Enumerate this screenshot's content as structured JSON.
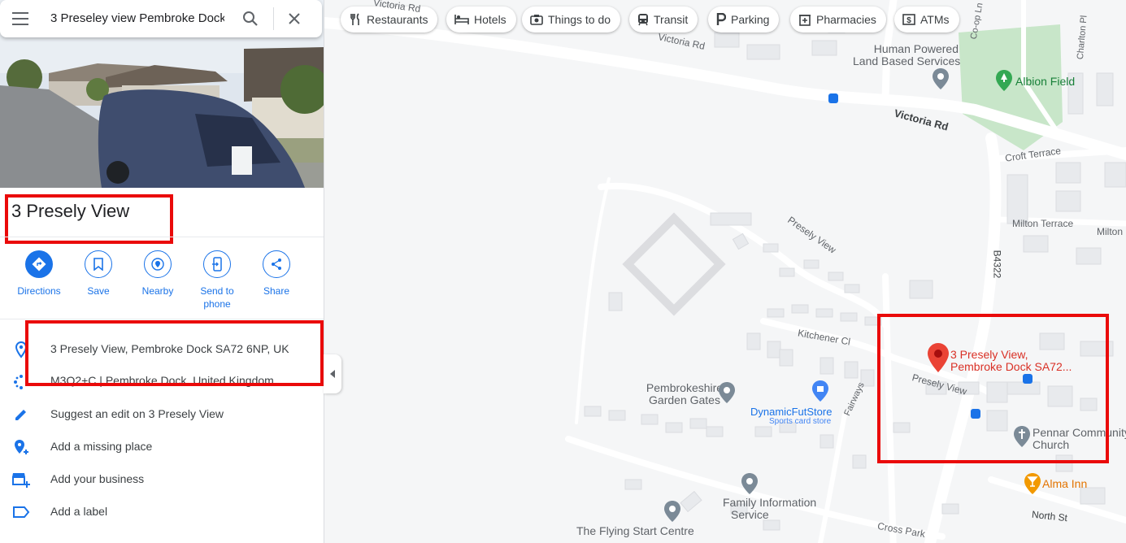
{
  "search": {
    "query": "3 Preseley view Pembroke Dock"
  },
  "place": {
    "title": "3 Presely View"
  },
  "actions": [
    {
      "label": "Directions",
      "icon": "directions-icon"
    },
    {
      "label": "Save",
      "icon": "bookmark-icon"
    },
    {
      "label": "Nearby",
      "icon": "nearby-icon"
    },
    {
      "label": "Send to\nphone",
      "icon": "send-to-phone-icon"
    },
    {
      "label": "Share",
      "icon": "share-icon"
    }
  ],
  "details": {
    "address": "3 Presely View, Pembroke Dock SA72 6NP, UK",
    "plus_code": "M3Q2+C | Pembroke Dock, United Kingdom",
    "suggest_edit": "Suggest an edit on 3 Presely View",
    "add_missing_place": "Add a missing place",
    "add_business": "Add your business",
    "add_label": "Add a label"
  },
  "chips": [
    {
      "label": "Restaurants",
      "icon": "restaurant-icon"
    },
    {
      "label": "Hotels",
      "icon": "hotel-icon"
    },
    {
      "label": "Things to do",
      "icon": "camera-icon"
    },
    {
      "label": "Transit",
      "icon": "transit-icon"
    },
    {
      "label": "Parking",
      "icon": "parking-icon"
    },
    {
      "label": "Pharmacies",
      "icon": "pharmacy-icon"
    },
    {
      "label": "ATMs",
      "icon": "atm-icon"
    }
  ],
  "map_labels": {
    "victoria_rd_1": "Victoria Rd",
    "victoria_rd_top": "Victoria Rd",
    "victoria_rd_2": "Victoria Rd",
    "human_powered": "Human Powered",
    "land_based": "Land Based Services",
    "albion_field": "Albion Field",
    "coop_ln": "Co-op Ln",
    "charlton_pl": "Charlton Pl",
    "croft_terrace": "Croft Terrace",
    "milton_terrace": "Milton Terrace",
    "milton": "Milton",
    "b4322": "B4322",
    "presely_view_1": "Presely View",
    "presely_view_2": "Presely View",
    "kitchener_cl": "Kitchener Cl",
    "pin_line1": "3 Presely View,",
    "pin_line2": "Pembroke Dock SA72...",
    "pembrokeshire_1": "Pembrokeshire",
    "pembrokeshire_2": "Garden Gates",
    "dynamic_fut": "DynamicFutStore",
    "dynamic_fut_sub": "Sports card store",
    "fairways": "Fairways",
    "pennar_1": "Pennar Community",
    "pennar_2": "Church",
    "alma_inn": "Alma Inn",
    "family_1": "Family Information",
    "family_2": "Service",
    "flying_start": "The Flying Start Centre",
    "cross_park": "Cross Park",
    "north_st": "North St"
  },
  "colors": {
    "accent": "#1a73e8",
    "highlight_box": "#ea0a0a",
    "pin": "#ea4335",
    "park": "#c8e6c9"
  }
}
